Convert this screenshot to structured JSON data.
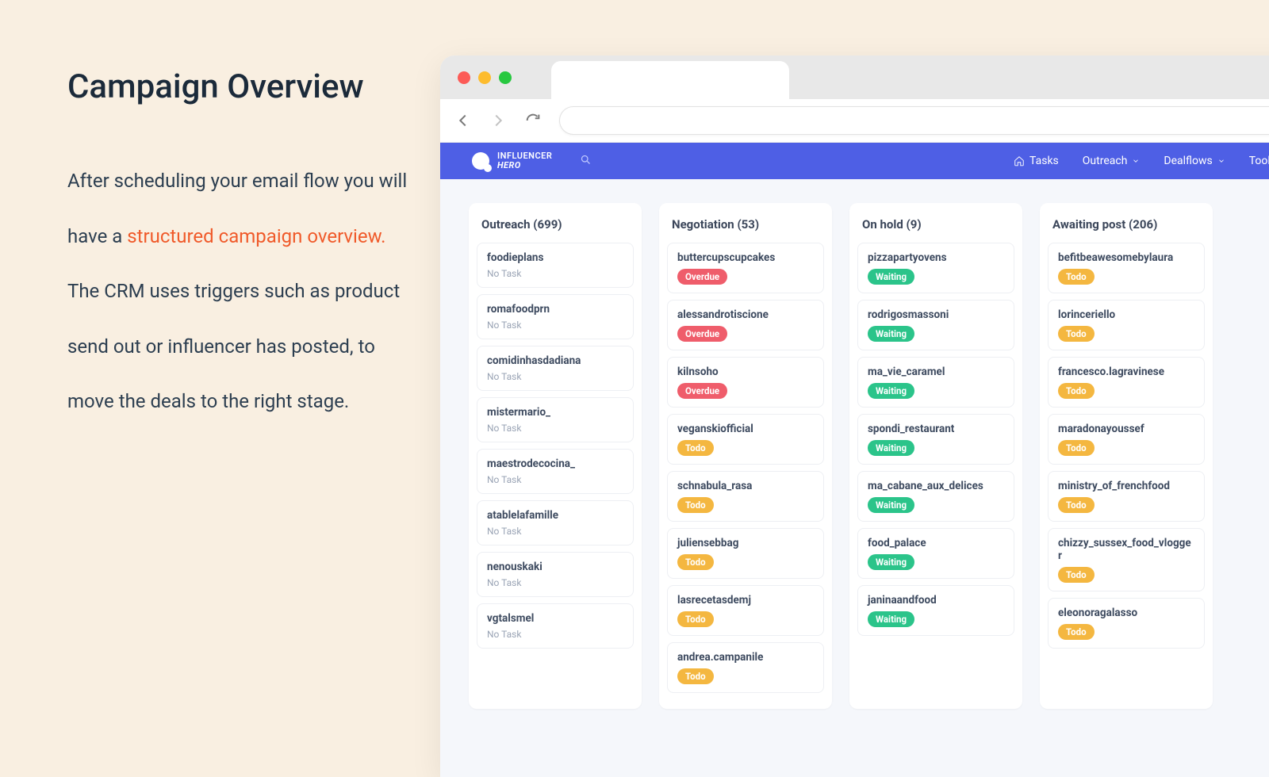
{
  "heading": "Campaign Overview",
  "body_pre": "After scheduling your email flow you will have a ",
  "body_hl": "structured campaign overview.",
  "body_post": " The CRM uses triggers such as product send out or influencer has posted,  to move the deals to the right stage.",
  "brand": {
    "line1": "INFLUENCER",
    "line2": "HERO"
  },
  "nav": {
    "tasks": "Tasks",
    "outreach": "Outreach",
    "dealflows": "Dealflows",
    "tools": "Tools"
  },
  "status_labels": {
    "notask": "No Task",
    "todo": "Todo",
    "overdue": "Overdue",
    "waiting": "Waiting"
  },
  "columns": [
    {
      "title": "Outreach (699)",
      "cards": [
        {
          "name": "foodieplans",
          "status": "notask"
        },
        {
          "name": "romafoodprn",
          "status": "notask"
        },
        {
          "name": "comidinhasdadiana",
          "status": "notask"
        },
        {
          "name": "mistermario_",
          "status": "notask"
        },
        {
          "name": "maestrodecocina_",
          "status": "notask"
        },
        {
          "name": "atablelafamille",
          "status": "notask"
        },
        {
          "name": "nenouskaki",
          "status": "notask"
        },
        {
          "name": "vgtalsmel",
          "status": "notask"
        }
      ]
    },
    {
      "title": "Negotiation (53)",
      "cards": [
        {
          "name": "buttercupscupcakes",
          "status": "overdue"
        },
        {
          "name": "alessandrotiscione",
          "status": "overdue"
        },
        {
          "name": "kilnsoho",
          "status": "overdue"
        },
        {
          "name": "veganskiofficial",
          "status": "todo"
        },
        {
          "name": "schnabula_rasa",
          "status": "todo"
        },
        {
          "name": "juliensebbag",
          "status": "todo"
        },
        {
          "name": "lasrecetasdemj",
          "status": "todo"
        },
        {
          "name": "andrea.campanile",
          "status": "todo"
        }
      ]
    },
    {
      "title": "On hold (9)",
      "cards": [
        {
          "name": "pizzapartyovens",
          "status": "waiting"
        },
        {
          "name": "rodrigosmassoni",
          "status": "waiting"
        },
        {
          "name": "ma_vie_caramel",
          "status": "waiting"
        },
        {
          "name": "spondi_restaurant",
          "status": "waiting"
        },
        {
          "name": "ma_cabane_aux_delices",
          "status": "waiting"
        },
        {
          "name": "food_palace",
          "status": "waiting"
        },
        {
          "name": "janinaandfood",
          "status": "waiting"
        }
      ]
    },
    {
      "title": "Awaiting post (206)",
      "cards": [
        {
          "name": "befitbeawesomebylaura",
          "status": "todo"
        },
        {
          "name": "lorinceriello",
          "status": "todo"
        },
        {
          "name": "francesco.lagravinese",
          "status": "todo"
        },
        {
          "name": "maradonayoussef",
          "status": "todo"
        },
        {
          "name": "ministry_of_frenchfood",
          "status": "todo"
        },
        {
          "name": "chizzy_sussex_food_vlogger",
          "status": "todo"
        },
        {
          "name": "eleonoragalasso",
          "status": "todo"
        }
      ]
    }
  ]
}
